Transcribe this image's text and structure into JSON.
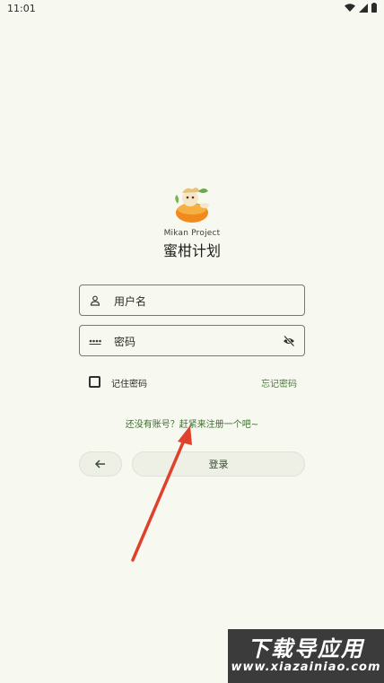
{
  "status_bar": {
    "time": "11:01"
  },
  "app": {
    "subtitle": "Mikan Project",
    "title": "蜜柑计划"
  },
  "login_form": {
    "username_placeholder": "用户名",
    "password_placeholder": "密码",
    "remember_label": "记住密码",
    "remember_checked": false,
    "forgot_label": "忘记密码",
    "register_prompt": "还没有账号？赶紧来注册一个吧~",
    "login_label": "登录"
  },
  "watermark": {
    "main": "下载导应用",
    "url": "www.xiazainiao.com"
  },
  "colors": {
    "background": "#f7f9f1",
    "accent_green": "#4d7a3a",
    "arrow_red": "#e0412c"
  }
}
